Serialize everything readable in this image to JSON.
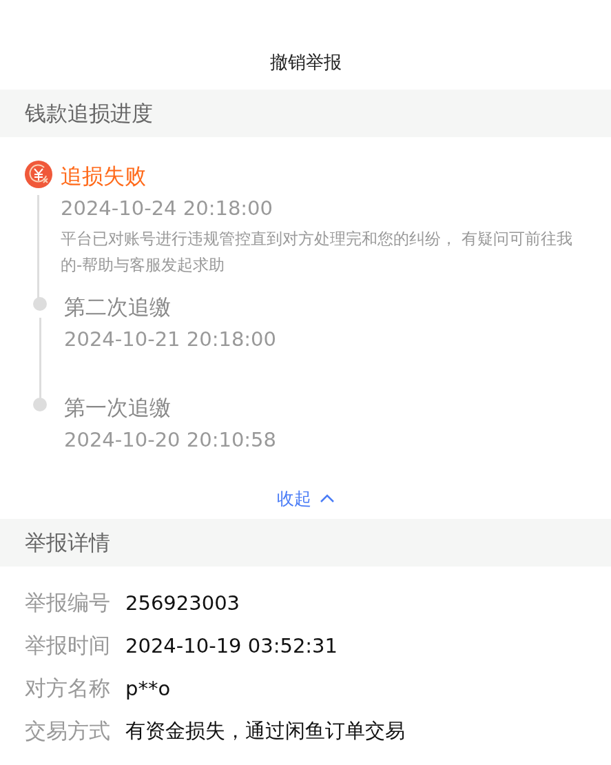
{
  "revoke_button": "撤销举报",
  "recovery": {
    "title": "钱款追损进度",
    "steps": [
      {
        "kind": "failed",
        "title": "追损失败",
        "time": "2024-10-24 20:18:00",
        "description": "平台已对账号进行违规管控直到对方处理完和您的纠纷， 有疑问可前往我的-帮助与客服发起求助"
      },
      {
        "kind": "past",
        "title": "第二次追缴",
        "time": "2024-10-21 20:18:00"
      },
      {
        "kind": "past",
        "title": "第一次追缴",
        "time": "2024-10-20 20:10:58"
      }
    ],
    "collapse_link": "收起"
  },
  "report_details": {
    "title": "举报详情",
    "rows": [
      {
        "label": "举报编号",
        "value": "256923003"
      },
      {
        "label": "举报时间",
        "value": "2024-10-19 03:52:31"
      },
      {
        "label": "对方名称",
        "value": "p**o"
      },
      {
        "label": "交易方式",
        "value": "有资金损失，通过闲鱼订单交易"
      }
    ]
  }
}
